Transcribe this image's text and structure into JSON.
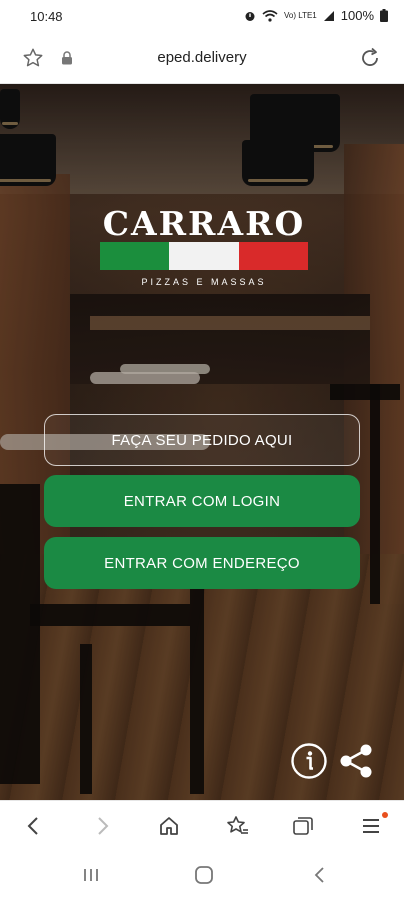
{
  "status_bar": {
    "time": "10:48",
    "network": "Vo) LTE1",
    "battery": "100%"
  },
  "browser": {
    "url": "eped.delivery"
  },
  "brand": {
    "name": "CARRARO",
    "tagline": "PIZZAS E MASSAS",
    "flag_colors": [
      "#1b8e3d",
      "#f2f2f2",
      "#d92a2a"
    ]
  },
  "actions": {
    "order_label": "FAÇA SEU PEDIDO AQUI",
    "login_label": "ENTRAR COM LOGIN",
    "address_label": "ENTRAR COM ENDEREÇO",
    "accent_color": "#1b8a44"
  },
  "icons": {
    "info": "info-icon",
    "share": "share-icon",
    "star": "star-icon",
    "lock": "lock-icon",
    "reload": "reload-icon"
  }
}
